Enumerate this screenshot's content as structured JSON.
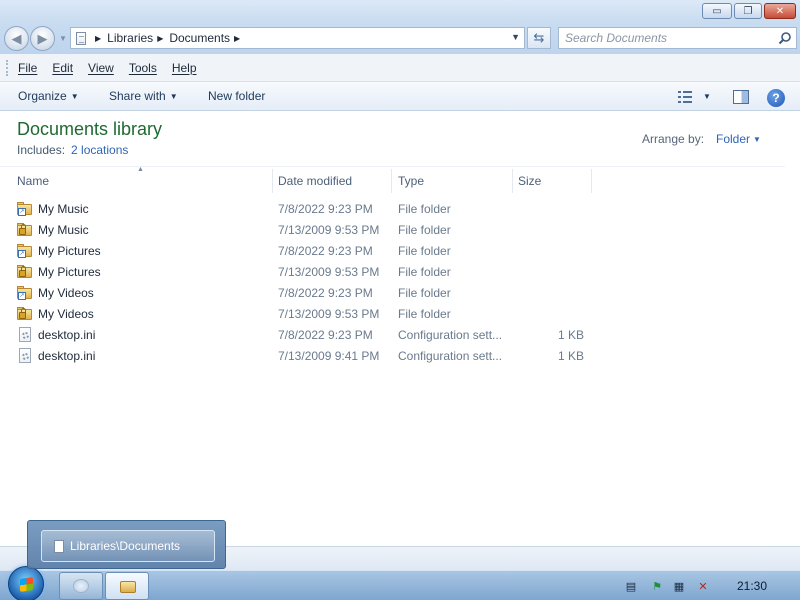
{
  "window": {
    "minimize_label": "▭",
    "maximize_label": "❐",
    "close_label": "✕"
  },
  "nav": {
    "back_glyph": "◀",
    "forward_glyph": "▶",
    "breadcrumbs": [
      "Libraries",
      "Documents"
    ],
    "search_placeholder": "Search Documents"
  },
  "menubar": {
    "items": [
      "File",
      "Edit",
      "View",
      "Tools",
      "Help"
    ]
  },
  "commandbar": {
    "organize": "Organize",
    "share_with": "Share with",
    "new_folder": "New folder",
    "help_glyph": "?"
  },
  "library": {
    "title": "Documents library",
    "includes_label": "Includes:",
    "locations_link": "2 locations",
    "arrange_label": "Arrange by:",
    "arrange_value": "Folder"
  },
  "columns": [
    "Name",
    "Date modified",
    "Type",
    "Size"
  ],
  "files": [
    {
      "name": "My Music",
      "date": "7/8/2022 9:23 PM",
      "type": "File folder",
      "size": "",
      "icon": "folder-shortcut-icon"
    },
    {
      "name": "My Music",
      "date": "7/13/2009 9:53 PM",
      "type": "File folder",
      "size": "",
      "icon": "folder-lock-icon"
    },
    {
      "name": "My Pictures",
      "date": "7/8/2022 9:23 PM",
      "type": "File folder",
      "size": "",
      "icon": "folder-shortcut-icon"
    },
    {
      "name": "My Pictures",
      "date": "7/13/2009 9:53 PM",
      "type": "File folder",
      "size": "",
      "icon": "folder-lock-icon"
    },
    {
      "name": "My Videos",
      "date": "7/8/2022 9:23 PM",
      "type": "File folder",
      "size": "",
      "icon": "folder-shortcut-icon"
    },
    {
      "name": "My Videos",
      "date": "7/13/2009 9:53 PM",
      "type": "File folder",
      "size": "",
      "icon": "folder-lock-icon"
    },
    {
      "name": "desktop.ini",
      "date": "7/8/2022 9:23 PM",
      "type": "Configuration sett...",
      "size": "1 KB",
      "icon": "config-file-icon"
    },
    {
      "name": "desktop.ini",
      "date": "7/13/2009 9:41 PM",
      "type": "Configuration sett...",
      "size": "1 KB",
      "icon": "config-file-icon"
    }
  ],
  "taskbar": {
    "thumbnail_label": "Libraries\\Documents",
    "clock": "21:30"
  },
  "colors": {
    "library_title": "#1e6a31",
    "link": "#2f64b6",
    "taskbar": "#7ea6cf"
  }
}
